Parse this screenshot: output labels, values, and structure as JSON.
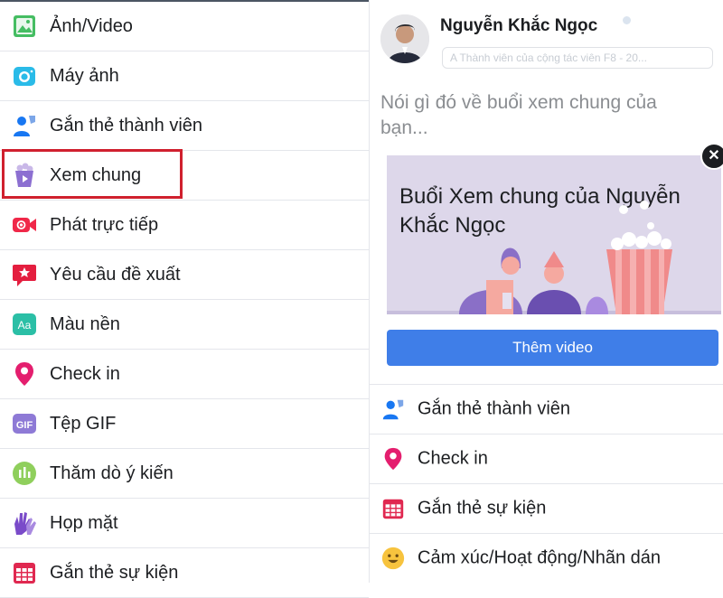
{
  "left_menu": {
    "items": [
      {
        "label": "Ảnh/Video",
        "icon": "photo-video-icon"
      },
      {
        "label": "Máy ảnh",
        "icon": "camera-icon"
      },
      {
        "label": "Gắn thẻ thành viên",
        "icon": "tag-people-icon"
      },
      {
        "label": "Xem chung",
        "icon": "watch-party-icon"
      },
      {
        "label": "Phát trực tiếp",
        "icon": "live-video-icon"
      },
      {
        "label": "Yêu cầu đề xuất",
        "icon": "recommendation-icon"
      },
      {
        "label": "Màu nền",
        "icon": "background-color-icon"
      },
      {
        "label": "Check in",
        "icon": "location-pin-icon"
      },
      {
        "label": "Tệp GIF",
        "icon": "gif-icon"
      },
      {
        "label": "Thăm dò ý kiến",
        "icon": "poll-icon"
      },
      {
        "label": "Họp mặt",
        "icon": "meetup-icon"
      },
      {
        "label": "Gắn thẻ sự kiện",
        "icon": "event-icon"
      }
    ]
  },
  "composer": {
    "user_name": "Nguyễn Khắc Ngọc",
    "audience_text": "A Thành viên của cộng tác viên F8 - 20...",
    "placeholder": "Nói gì đó về buổi xem chung của bạn...",
    "card_title": "Buổi Xem chung của Nguyễn Khắc Ngọc",
    "add_video_label": "Thêm video",
    "close_symbol": "✕",
    "options": [
      {
        "label": "Gắn thẻ thành viên",
        "icon": "tag-people-icon"
      },
      {
        "label": "Check in",
        "icon": "location-pin-icon"
      },
      {
        "label": "Gắn thẻ sự kiện",
        "icon": "event-icon"
      },
      {
        "label": "Cảm xúc/Hoạt động/Nhãn dán",
        "icon": "feeling-icon"
      }
    ]
  },
  "colors": {
    "highlight": "#d0202e",
    "primary_button": "#3f7ee8",
    "card_background": "#ddd7ea"
  }
}
